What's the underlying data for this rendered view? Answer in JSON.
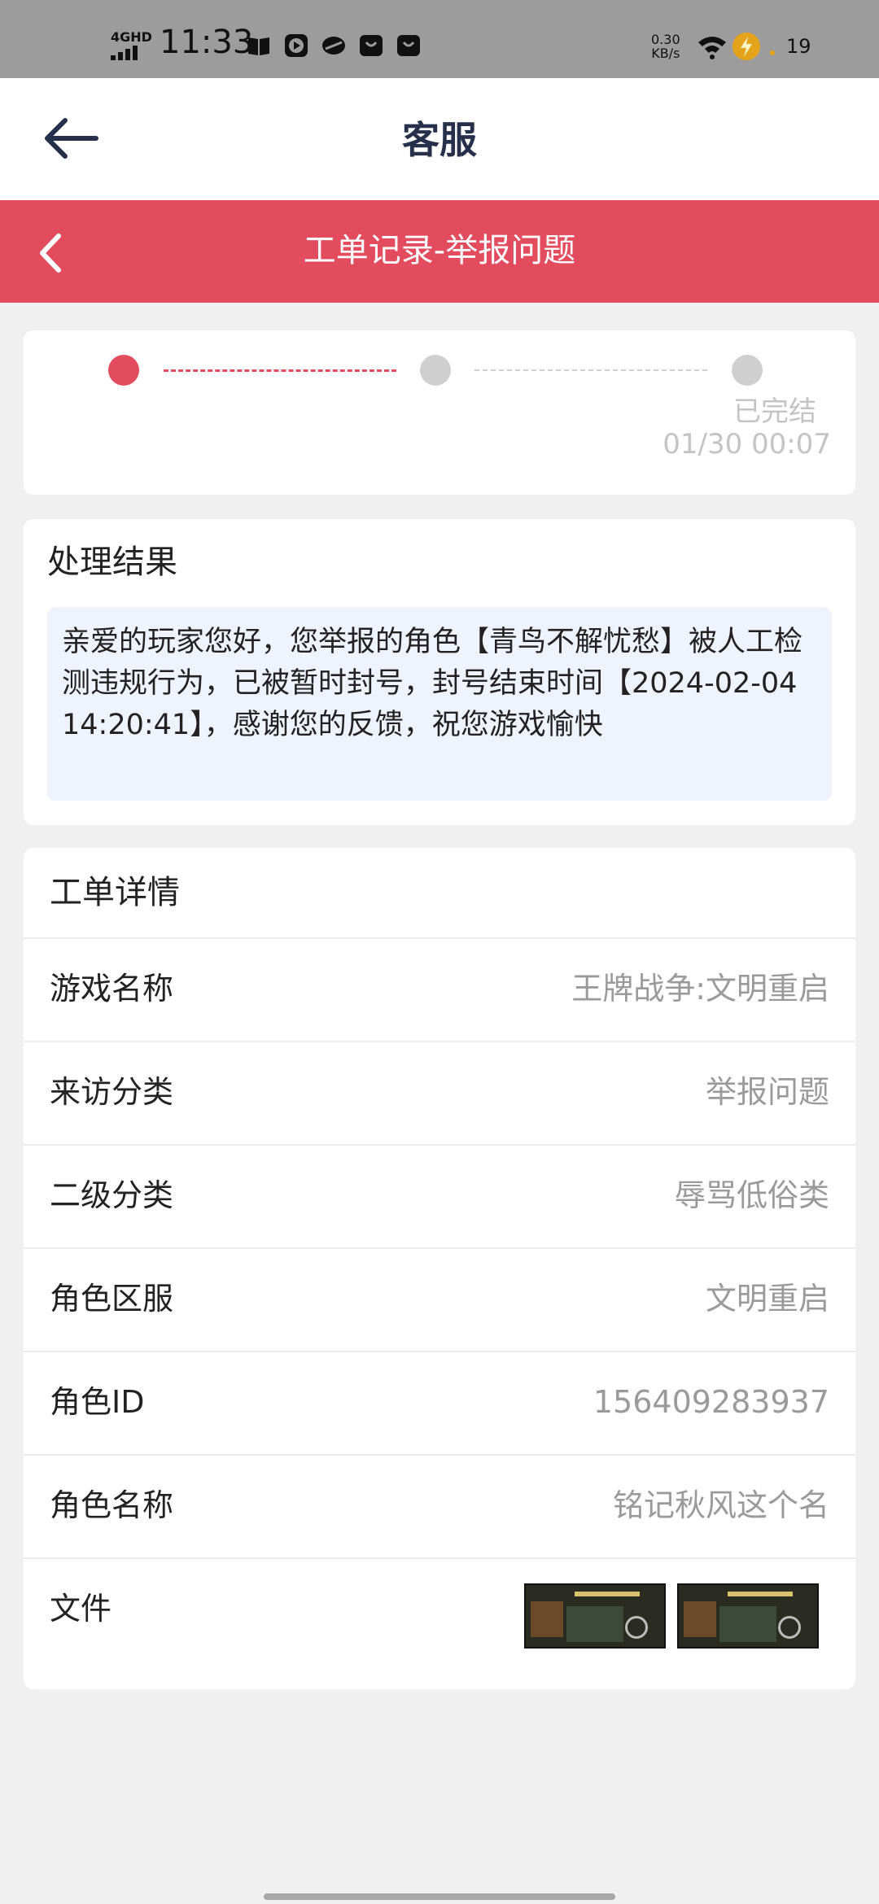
{
  "status_bar": {
    "network": "4GHD",
    "time": "11:33",
    "speed_value": "0.30",
    "speed_unit": "KB/s",
    "battery": "19"
  },
  "header": {
    "title": "客服"
  },
  "subbar": {
    "title": "工单记录-举报问题",
    "color": "#e24c5e"
  },
  "progress": {
    "steps": [
      {
        "state": "active"
      },
      {
        "state": "inactive"
      },
      {
        "state": "inactive",
        "label": "已完结",
        "time": "01/30 00:07"
      }
    ]
  },
  "result": {
    "title": "处理结果",
    "text": "亲爱的玩家您好，您举报的角色【青鸟不解忧愁】被人工检测违规行为，已被暂时封号，封号结束时间【2024-02-04 14:20:41】，感谢您的反馈，祝您游戏愉快"
  },
  "detail": {
    "title": "工单详情",
    "rows": [
      {
        "key": "游戏名称",
        "value": "王牌战争:文明重启"
      },
      {
        "key": "来访分类",
        "value": "举报问题"
      },
      {
        "key": "二级分类",
        "value": "辱骂低俗类"
      },
      {
        "key": "角色区服",
        "value": "文明重启"
      },
      {
        "key": "角色ID",
        "value": "156409283937"
      },
      {
        "key": "角色名称",
        "value": "铭记秋风这个名"
      },
      {
        "key": "文件",
        "value": ""
      }
    ]
  }
}
